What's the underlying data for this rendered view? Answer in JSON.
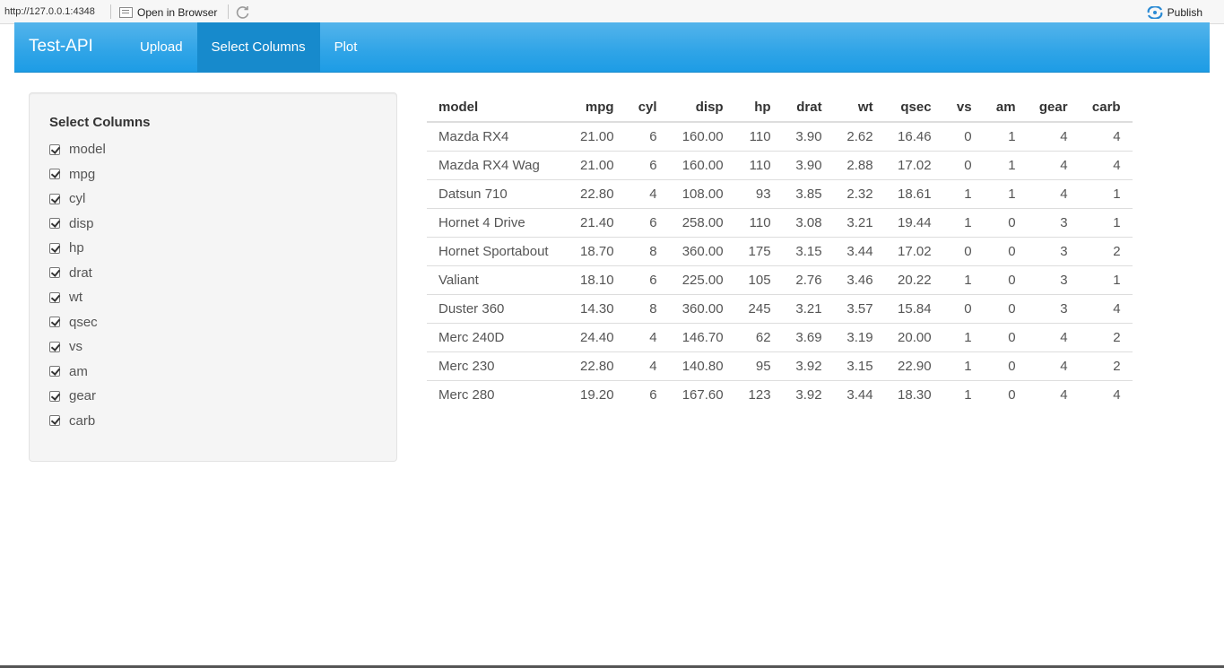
{
  "viewer": {
    "url": "http://127.0.0.1:4348",
    "open_in_browser": "Open in Browser",
    "publish": "Publish"
  },
  "navbar": {
    "brand": "Test-API",
    "tabs": [
      {
        "label": "Upload",
        "active": false
      },
      {
        "label": "Select Columns",
        "active": true
      },
      {
        "label": "Plot",
        "active": false
      }
    ]
  },
  "sidebar": {
    "title": "Select Columns",
    "options": [
      {
        "label": "model",
        "checked": true
      },
      {
        "label": "mpg",
        "checked": true
      },
      {
        "label": "cyl",
        "checked": true
      },
      {
        "label": "disp",
        "checked": true
      },
      {
        "label": "hp",
        "checked": true
      },
      {
        "label": "drat",
        "checked": true
      },
      {
        "label": "wt",
        "checked": true
      },
      {
        "label": "qsec",
        "checked": true
      },
      {
        "label": "vs",
        "checked": true
      },
      {
        "label": "am",
        "checked": true
      },
      {
        "label": "gear",
        "checked": true
      },
      {
        "label": "carb",
        "checked": true
      }
    ]
  },
  "table": {
    "columns": [
      "model",
      "mpg",
      "cyl",
      "disp",
      "hp",
      "drat",
      "wt",
      "qsec",
      "vs",
      "am",
      "gear",
      "carb"
    ],
    "rows": [
      [
        "Mazda RX4",
        "21.00",
        "6",
        "160.00",
        "110",
        "3.90",
        "2.62",
        "16.46",
        "0",
        "1",
        "4",
        "4"
      ],
      [
        "Mazda RX4 Wag",
        "21.00",
        "6",
        "160.00",
        "110",
        "3.90",
        "2.88",
        "17.02",
        "0",
        "1",
        "4",
        "4"
      ],
      [
        "Datsun 710",
        "22.80",
        "4",
        "108.00",
        "93",
        "3.85",
        "2.32",
        "18.61",
        "1",
        "1",
        "4",
        "1"
      ],
      [
        "Hornet 4 Drive",
        "21.40",
        "6",
        "258.00",
        "110",
        "3.08",
        "3.21",
        "19.44",
        "1",
        "0",
        "3",
        "1"
      ],
      [
        "Hornet Sportabout",
        "18.70",
        "8",
        "360.00",
        "175",
        "3.15",
        "3.44",
        "17.02",
        "0",
        "0",
        "3",
        "2"
      ],
      [
        "Valiant",
        "18.10",
        "6",
        "225.00",
        "105",
        "2.76",
        "3.46",
        "20.22",
        "1",
        "0",
        "3",
        "1"
      ],
      [
        "Duster 360",
        "14.30",
        "8",
        "360.00",
        "245",
        "3.21",
        "3.57",
        "15.84",
        "0",
        "0",
        "3",
        "4"
      ],
      [
        "Merc 240D",
        "24.40",
        "4",
        "146.70",
        "62",
        "3.69",
        "3.19",
        "20.00",
        "1",
        "0",
        "4",
        "2"
      ],
      [
        "Merc 230",
        "22.80",
        "4",
        "140.80",
        "95",
        "3.92",
        "3.15",
        "22.90",
        "1",
        "0",
        "4",
        "2"
      ],
      [
        "Merc 280",
        "19.20",
        "6",
        "167.60",
        "123",
        "3.92",
        "3.44",
        "18.30",
        "1",
        "0",
        "4",
        "4"
      ]
    ]
  }
}
